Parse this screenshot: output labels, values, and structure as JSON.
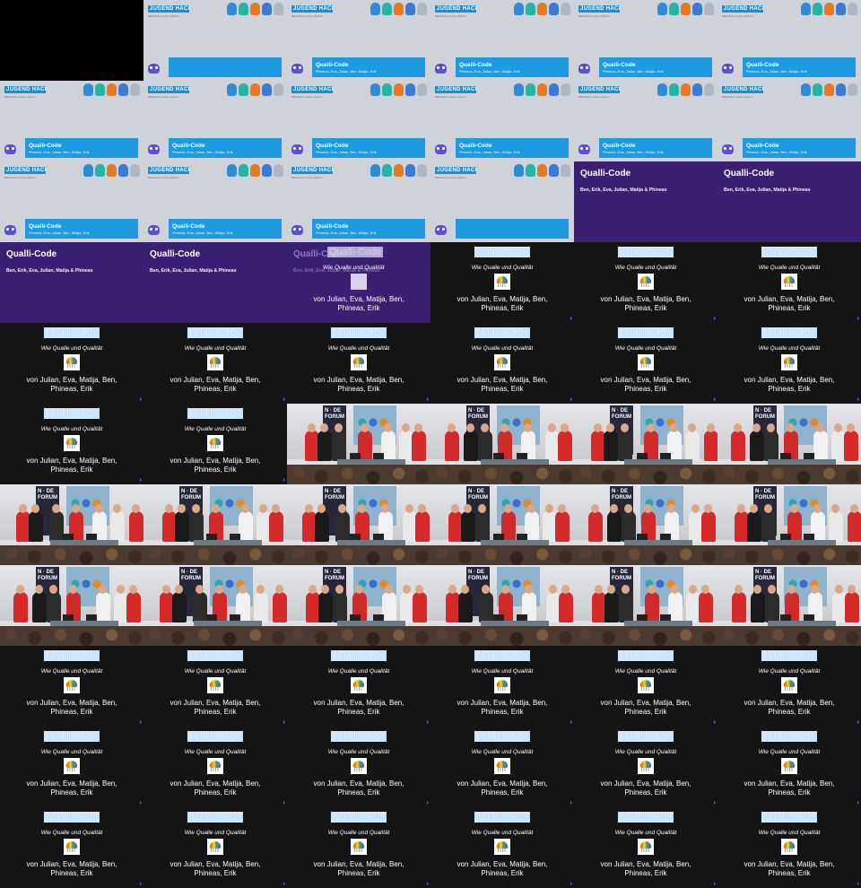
{
  "title_card": {
    "logo_text": "JUGEND HACKT",
    "subtitle": "Mitmachen, fertig machen",
    "project": "Qualli-Code",
    "names": "Phineas, Eva, Julian, Ben, Matija, Erik",
    "colors": {
      "background": "#cfd2d8",
      "bar": "#1e9be0",
      "owl": "#5b4fd6"
    },
    "mascot_colors": [
      "#2a8fd6",
      "#27b3a6",
      "#e67a22",
      "#3a7bd5",
      "#b0b6c2"
    ]
  },
  "purple_slide": {
    "title": "Qualli-Code",
    "names": "Ben, Erik, Eva, Julian, Matija & Phineas",
    "color": "#3a1f72"
  },
  "dark_slide": {
    "title": "Qualli-Code",
    "subtitle": "Wie Qualle und Qualität",
    "authors_line1": "von Julian, Eva, Matija, Ben,",
    "authors_line2": "Phineas, Erik",
    "color": "#141414"
  },
  "stage_photo": {
    "banner_text": "N · DE FORUM",
    "shirt_colors": [
      "#d62a2a",
      "#1a1a1a",
      "#2c2c2c",
      "#cf2b2b",
      "#f1f1f1",
      "#e9e9ea"
    ]
  },
  "tiles": [
    "blank",
    "card-empty",
    "card",
    "card",
    "card",
    "card",
    "card",
    "card",
    "card",
    "card",
    "card",
    "card",
    "card",
    "card",
    "card",
    "card-empty",
    "purple",
    "purple",
    "purple",
    "purple",
    "transition",
    "dark",
    "dark",
    "dark",
    "dark",
    "dark",
    "dark",
    "dark",
    "dark",
    "dark",
    "dark",
    "dark",
    "photo",
    "photo",
    "photo",
    "photo",
    "photo",
    "photo",
    "photo",
    "photo",
    "photo",
    "photo",
    "photo",
    "photo",
    "photo",
    "photo",
    "photo",
    "photo",
    "dark",
    "dark",
    "dark",
    "dark",
    "dark",
    "dark",
    "dark",
    "dark",
    "dark",
    "dark",
    "dark",
    "dark",
    "dark",
    "dark",
    "dark",
    "dark",
    "dark",
    "dark"
  ]
}
